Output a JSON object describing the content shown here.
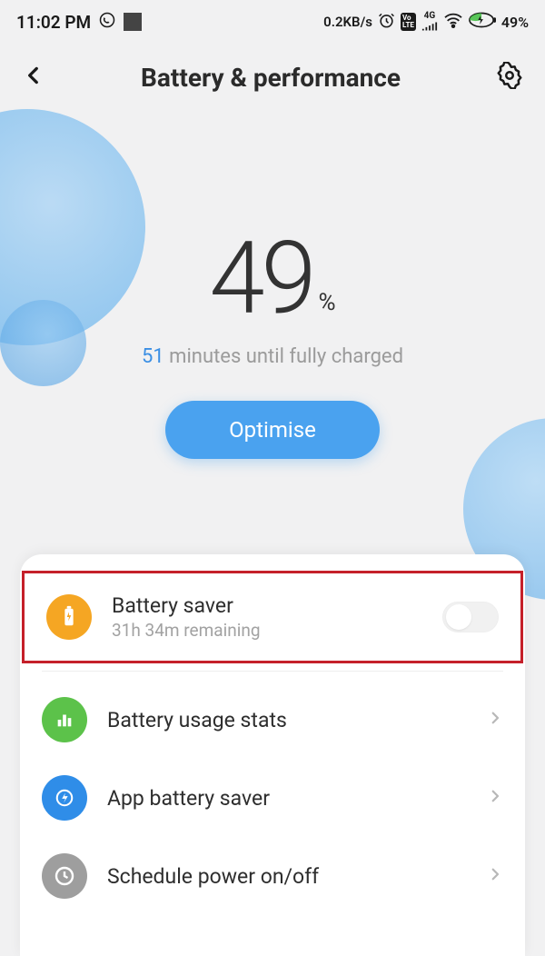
{
  "status": {
    "time": "11:02 PM",
    "data_rate": "0.2KB/s",
    "network_label": "4G",
    "battery_percent": "49%"
  },
  "header": {
    "title": "Battery & performance"
  },
  "hero": {
    "percent": "49",
    "percent_symbol": "%",
    "minutes": "51",
    "message_rest": " minutes until fully charged",
    "optimise_label": "Optimise"
  },
  "rows": {
    "battery_saver": {
      "title": "Battery saver",
      "sub": "31h 34m remaining"
    },
    "usage_stats": {
      "title": "Battery usage stats"
    },
    "app_saver": {
      "title": "App battery saver"
    },
    "schedule": {
      "title": "Schedule power on/off"
    }
  }
}
